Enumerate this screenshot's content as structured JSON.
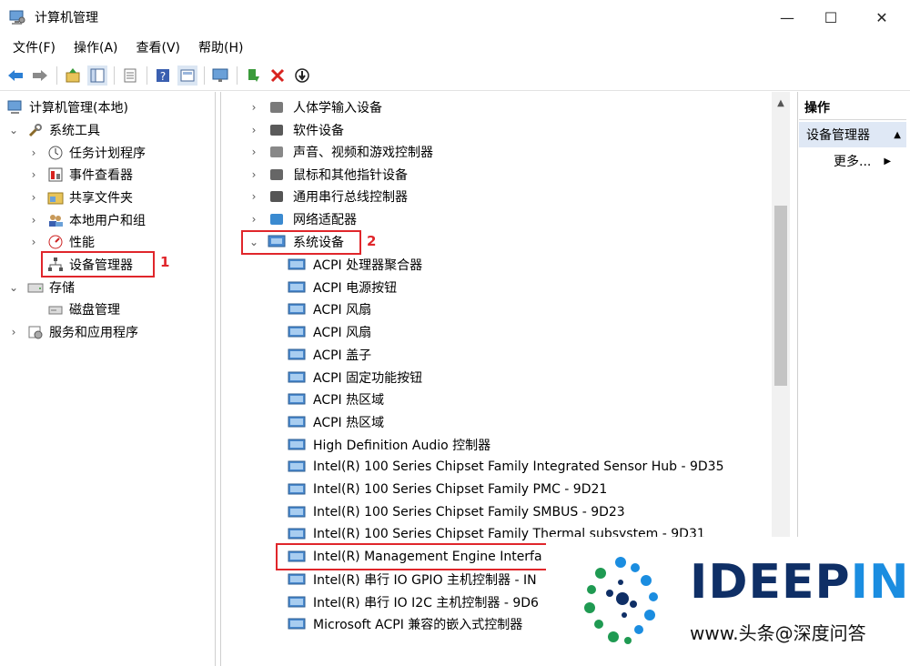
{
  "window": {
    "title": "计算机管理",
    "minimize_glyph": "—",
    "maximize_glyph": "☐",
    "close_glyph": "✕"
  },
  "menu": [
    "文件(F)",
    "操作(A)",
    "查看(V)",
    "帮助(H)"
  ],
  "toolbar": {
    "icons": [
      "back-icon",
      "forward-icon",
      "up-folder-icon",
      "show-hide-tree-icon",
      "export-icon",
      "help-icon",
      "properties-icon",
      "monitor-icon",
      "update-driver-icon",
      "uninstall-icon",
      "disable-icon"
    ]
  },
  "left_tree": {
    "root": "计算机管理(本地)",
    "system_tools": "系统工具",
    "task_scheduler": "任务计划程序",
    "event_viewer": "事件查看器",
    "shared_folders": "共享文件夹",
    "local_users": "本地用户和组",
    "performance": "性能",
    "device_manager": "设备管理器",
    "storage": "存储",
    "disk_management": "磁盘管理",
    "services": "服务和应用程序"
  },
  "device_tree": {
    "categories": [
      "人体学输入设备",
      "软件设备",
      "声音、视频和游戏控制器",
      "鼠标和其他指针设备",
      "通用串行总线控制器",
      "网络适配器"
    ],
    "expanded_category": "系统设备",
    "devices": [
      "ACPI 处理器聚合器",
      "ACPI 电源按钮",
      "ACPI 风扇",
      "ACPI 风扇",
      "ACPI 盖子",
      "ACPI 固定功能按钮",
      "ACPI 热区域",
      "ACPI 热区域",
      "High Definition Audio 控制器",
      "Intel(R) 100 Series Chipset Family Integrated Sensor Hub - 9D35",
      "Intel(R) 100 Series Chipset Family PMC - 9D21",
      "Intel(R) 100 Series Chipset Family SMBUS - 9D23",
      "Intel(R) 100 Series Chipset Family Thermal subsystem - 9D31",
      "Intel(R) Management Engine Interfa",
      "Intel(R) 串行 IO GPIO 主机控制器 - IN",
      "Intel(R) 串行 IO I2C 主机控制器 - 9D6",
      "Microsoft ACPI 兼容的嵌入式控制器"
    ]
  },
  "annotations": {
    "step1": "1",
    "step2": "2"
  },
  "actions": {
    "header": "操作",
    "section": "设备管理器",
    "more": "更多..."
  },
  "watermark": {
    "brand_dark": "IDEEP",
    "brand_light": "IN",
    "sub": "www.头条@深度问答"
  },
  "colors": {
    "highlight": "#e0262b",
    "selection": "#dfe8f5",
    "brand_navy": "#0f2f66",
    "brand_blue": "#1b8de0"
  }
}
